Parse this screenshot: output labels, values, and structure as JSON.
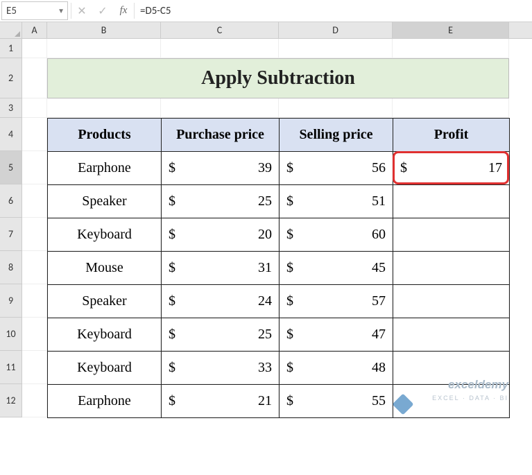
{
  "namebox": "E5",
  "formula": "=D5-C5",
  "fx_label": "fx",
  "columns": [
    "A",
    "B",
    "C",
    "D",
    "E"
  ],
  "row_numbers": [
    "1",
    "2",
    "3",
    "4",
    "5",
    "6",
    "7",
    "8",
    "9",
    "10",
    "11",
    "12"
  ],
  "title": "Apply Subtraction",
  "headers": {
    "products": "Products",
    "purchase": "Purchase price",
    "selling": "Selling price",
    "profit": "Profit"
  },
  "currency_symbol": "$",
  "rows": [
    {
      "product": "Earphone",
      "purchase": "39",
      "selling": "56",
      "profit": "17"
    },
    {
      "product": "Speaker",
      "purchase": "25",
      "selling": "51",
      "profit": ""
    },
    {
      "product": "Keyboard",
      "purchase": "20",
      "selling": "60",
      "profit": ""
    },
    {
      "product": "Mouse",
      "purchase": "31",
      "selling": "45",
      "profit": ""
    },
    {
      "product": "Speaker",
      "purchase": "24",
      "selling": "57",
      "profit": ""
    },
    {
      "product": "Keyboard",
      "purchase": "25",
      "selling": "47",
      "profit": ""
    },
    {
      "product": "Keyboard",
      "purchase": "33",
      "selling": "48",
      "profit": ""
    },
    {
      "product": "Earphone",
      "purchase": "21",
      "selling": "55",
      "profit": ""
    }
  ],
  "selected_cell": "E5",
  "watermark": {
    "brand": "exceldemy",
    "tag": "EXCEL · DATA · BI"
  },
  "chart_data": {
    "type": "table",
    "title": "Apply Subtraction",
    "columns": [
      "Products",
      "Purchase price",
      "Selling price",
      "Profit"
    ],
    "records": [
      [
        "Earphone",
        39,
        56,
        17
      ],
      [
        "Speaker",
        25,
        51,
        null
      ],
      [
        "Keyboard",
        20,
        60,
        null
      ],
      [
        "Mouse",
        31,
        45,
        null
      ],
      [
        "Speaker",
        24,
        57,
        null
      ],
      [
        "Keyboard",
        25,
        47,
        null
      ],
      [
        "Keyboard",
        33,
        48,
        null
      ],
      [
        "Earphone",
        21,
        55,
        null
      ]
    ],
    "formula": "Profit = Selling price - Purchase price"
  }
}
